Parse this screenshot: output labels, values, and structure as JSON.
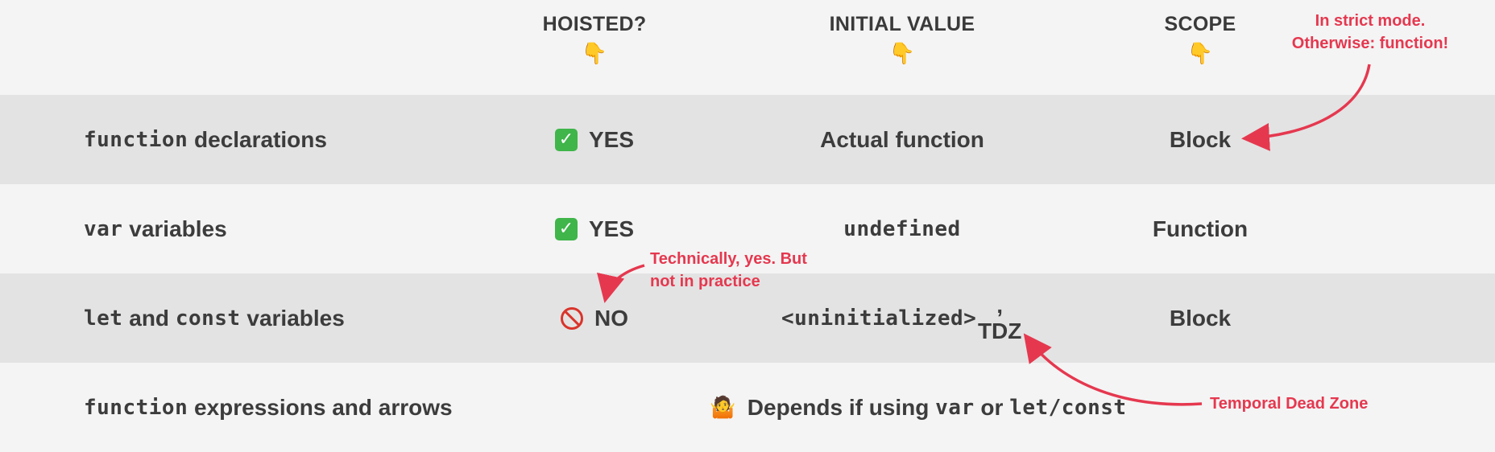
{
  "headers": {
    "hoisted": "HOISTED?",
    "initial_value": "INITIAL VALUE",
    "scope": "SCOPE",
    "pointer": "👇"
  },
  "rows": [
    {
      "label_code": "function",
      "label_text": " declarations",
      "hoisted_icon": "check-mark-icon",
      "hoisted": "YES",
      "initial_value": "Actual function",
      "scope": "Block"
    },
    {
      "label_code": "var",
      "label_text": " variables",
      "hoisted_icon": "check-mark-icon",
      "hoisted": "YES",
      "initial_value": "undefined",
      "scope": "Function"
    },
    {
      "label_code1": "let",
      "label_text1": " and ",
      "label_code2": "const",
      "label_text2": " variables",
      "hoisted_icon": "prohibited-icon",
      "hoisted": "NO",
      "initial_value_code": "<uninitialized>",
      "initial_value_text": ", TDZ",
      "scope": "Block"
    },
    {
      "label_code": "function",
      "label_text": " expressions and arrows",
      "shrug": "🤷",
      "depends_text": "Depends if using ",
      "depends_code1": "var",
      "depends_mid": " or ",
      "depends_code2": "let/const"
    }
  ],
  "annotations": {
    "strict_mode_line1": "In strict mode.",
    "strict_mode_line2": "Otherwise: function!",
    "technically_line1": "Technically, yes. But",
    "technically_line2": "not in practice",
    "tdz": "Temporal Dead Zone"
  },
  "colors": {
    "accent": "#e5384f",
    "shaded_row": "#e3e3e3",
    "background": "#f4f4f4",
    "check": "#3fb54a"
  }
}
